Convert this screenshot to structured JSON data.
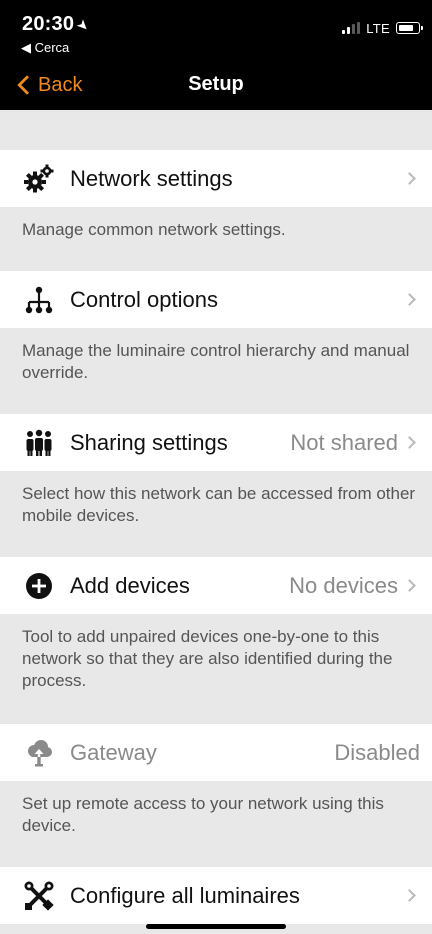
{
  "status_bar": {
    "time": "20:30",
    "back_app": "◀ Cerca",
    "network": "LTE"
  },
  "nav": {
    "back_label": "Back",
    "title": "Setup"
  },
  "items": [
    {
      "label": "Network settings",
      "value": "",
      "description": "Manage common network settings.",
      "icon": "gears-icon"
    },
    {
      "label": "Control options",
      "value": "",
      "description": "Manage the luminaire control hierarchy and manual override.",
      "icon": "hierarchy-icon"
    },
    {
      "label": "Sharing settings",
      "value": "Not shared",
      "description": "Select how this network can be accessed from other mobile devices.",
      "icon": "people-icon"
    },
    {
      "label": "Add devices",
      "value": "No devices",
      "description": "Tool to add unpaired devices one-by-one to this network so that they are also identified during the process.",
      "icon": "plus-circle-icon"
    },
    {
      "label": "Gateway",
      "value": "Disabled",
      "description": "Set up remote access to your network using this device.",
      "icon": "cloud-upload-icon"
    },
    {
      "label": "Configure all luminaires",
      "value": "",
      "description": "",
      "icon": "tools-icon"
    }
  ],
  "colors": {
    "accent": "#f08a1d",
    "background": "#e8e8e8",
    "row": "#ffffff",
    "header": "#000000"
  }
}
